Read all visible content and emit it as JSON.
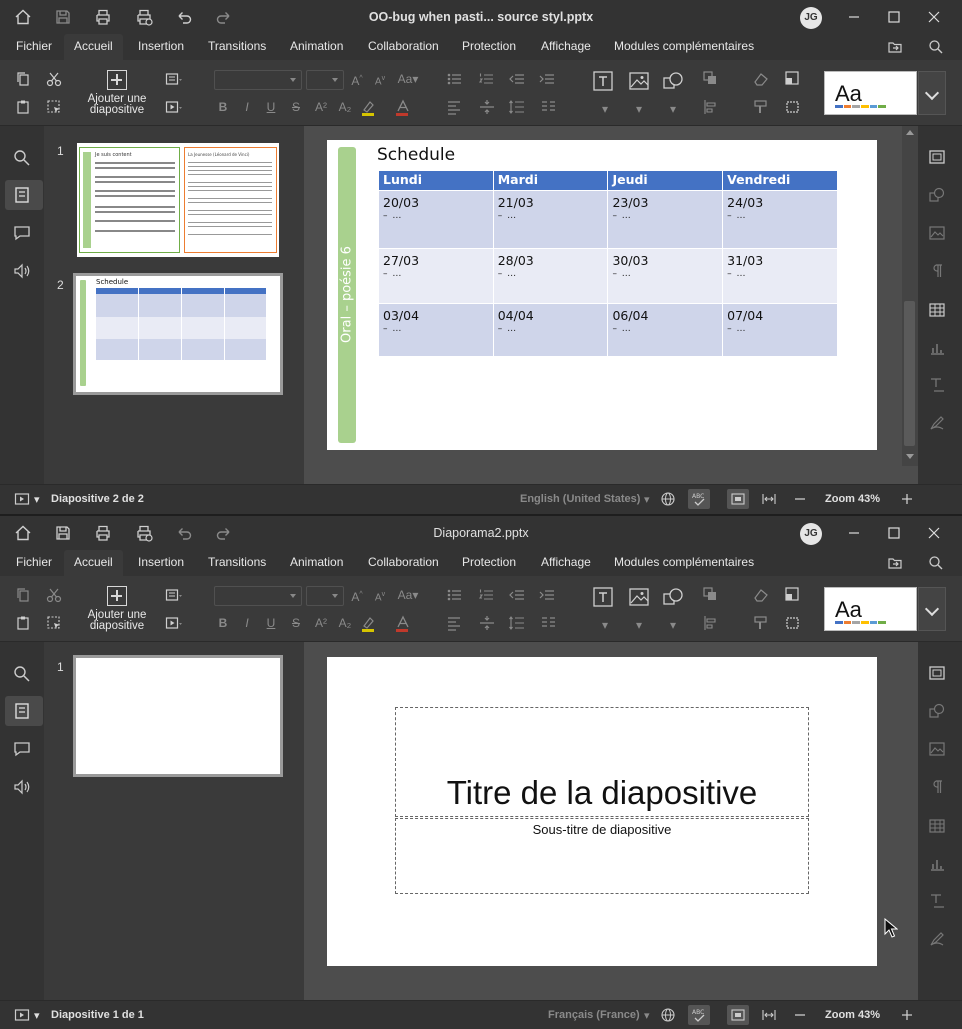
{
  "window1": {
    "title": "OO-bug when pasti... source styl.pptx",
    "avatar": "JG",
    "menu": [
      "Fichier",
      "Accueil",
      "Insertion",
      "Transitions",
      "Animation",
      "Collaboration",
      "Protection",
      "Affichage",
      "Modules complémentaires"
    ],
    "active_menu": "Accueil",
    "add_slide_label_1": "Ajouter une",
    "add_slide_label_2": "diapositive",
    "theme_preview": "Aa",
    "thumbnails": [
      {
        "number": "1",
        "left_title": "Je suis content",
        "right_title": "La Jeunesse (Léonard de Vinci)"
      },
      {
        "number": "2",
        "title": "Schedule"
      }
    ],
    "slide": {
      "title": "Schedule",
      "banner": "Oral – poésie 6",
      "headers": [
        "Lundi",
        "Mardi",
        "Jeudi",
        "Vendredi"
      ],
      "rows": [
        {
          "cells": [
            "20/03",
            "21/03",
            "23/03",
            "24/03"
          ],
          "subs": [
            "–  …",
            "–  …",
            "–  …",
            "–  …"
          ]
        },
        {
          "cells": [
            "27/03",
            "28/03",
            "30/03",
            "31/03"
          ],
          "subs": [
            "–  …",
            "–  …",
            "–  …",
            "–  …"
          ]
        },
        {
          "cells": [
            "03/04",
            "04/04",
            "06/04",
            "07/04"
          ],
          "subs": [
            "–  …",
            "–  …",
            "–  …",
            "–  …"
          ]
        }
      ]
    },
    "status": {
      "slide_counter": "Diapositive 2 de 2",
      "language": "English (United States)",
      "zoom": "Zoom 43%"
    }
  },
  "window2": {
    "title": "Diaporama2.pptx",
    "avatar": "JG",
    "menu": [
      "Fichier",
      "Accueil",
      "Insertion",
      "Transitions",
      "Animation",
      "Collaboration",
      "Protection",
      "Affichage",
      "Modules complémentaires"
    ],
    "active_menu": "Accueil",
    "add_slide_label_1": "Ajouter une",
    "add_slide_label_2": "diapositive",
    "theme_preview": "Aa",
    "thumbnails": [
      {
        "number": "1"
      }
    ],
    "slide": {
      "title_placeholder": "Titre de la diapositive",
      "subtitle_placeholder": "Sous-titre de diapositive"
    },
    "status": {
      "slide_counter": "Diapositive 1 de 1",
      "language": "Français (France)",
      "zoom": "Zoom 43%"
    }
  },
  "colors": {
    "accent_table_header": "#4472c4",
    "table_band_dark": "#cfd5ea",
    "table_band_light": "#e9ebf5",
    "banner_green": "#a9d18e"
  }
}
